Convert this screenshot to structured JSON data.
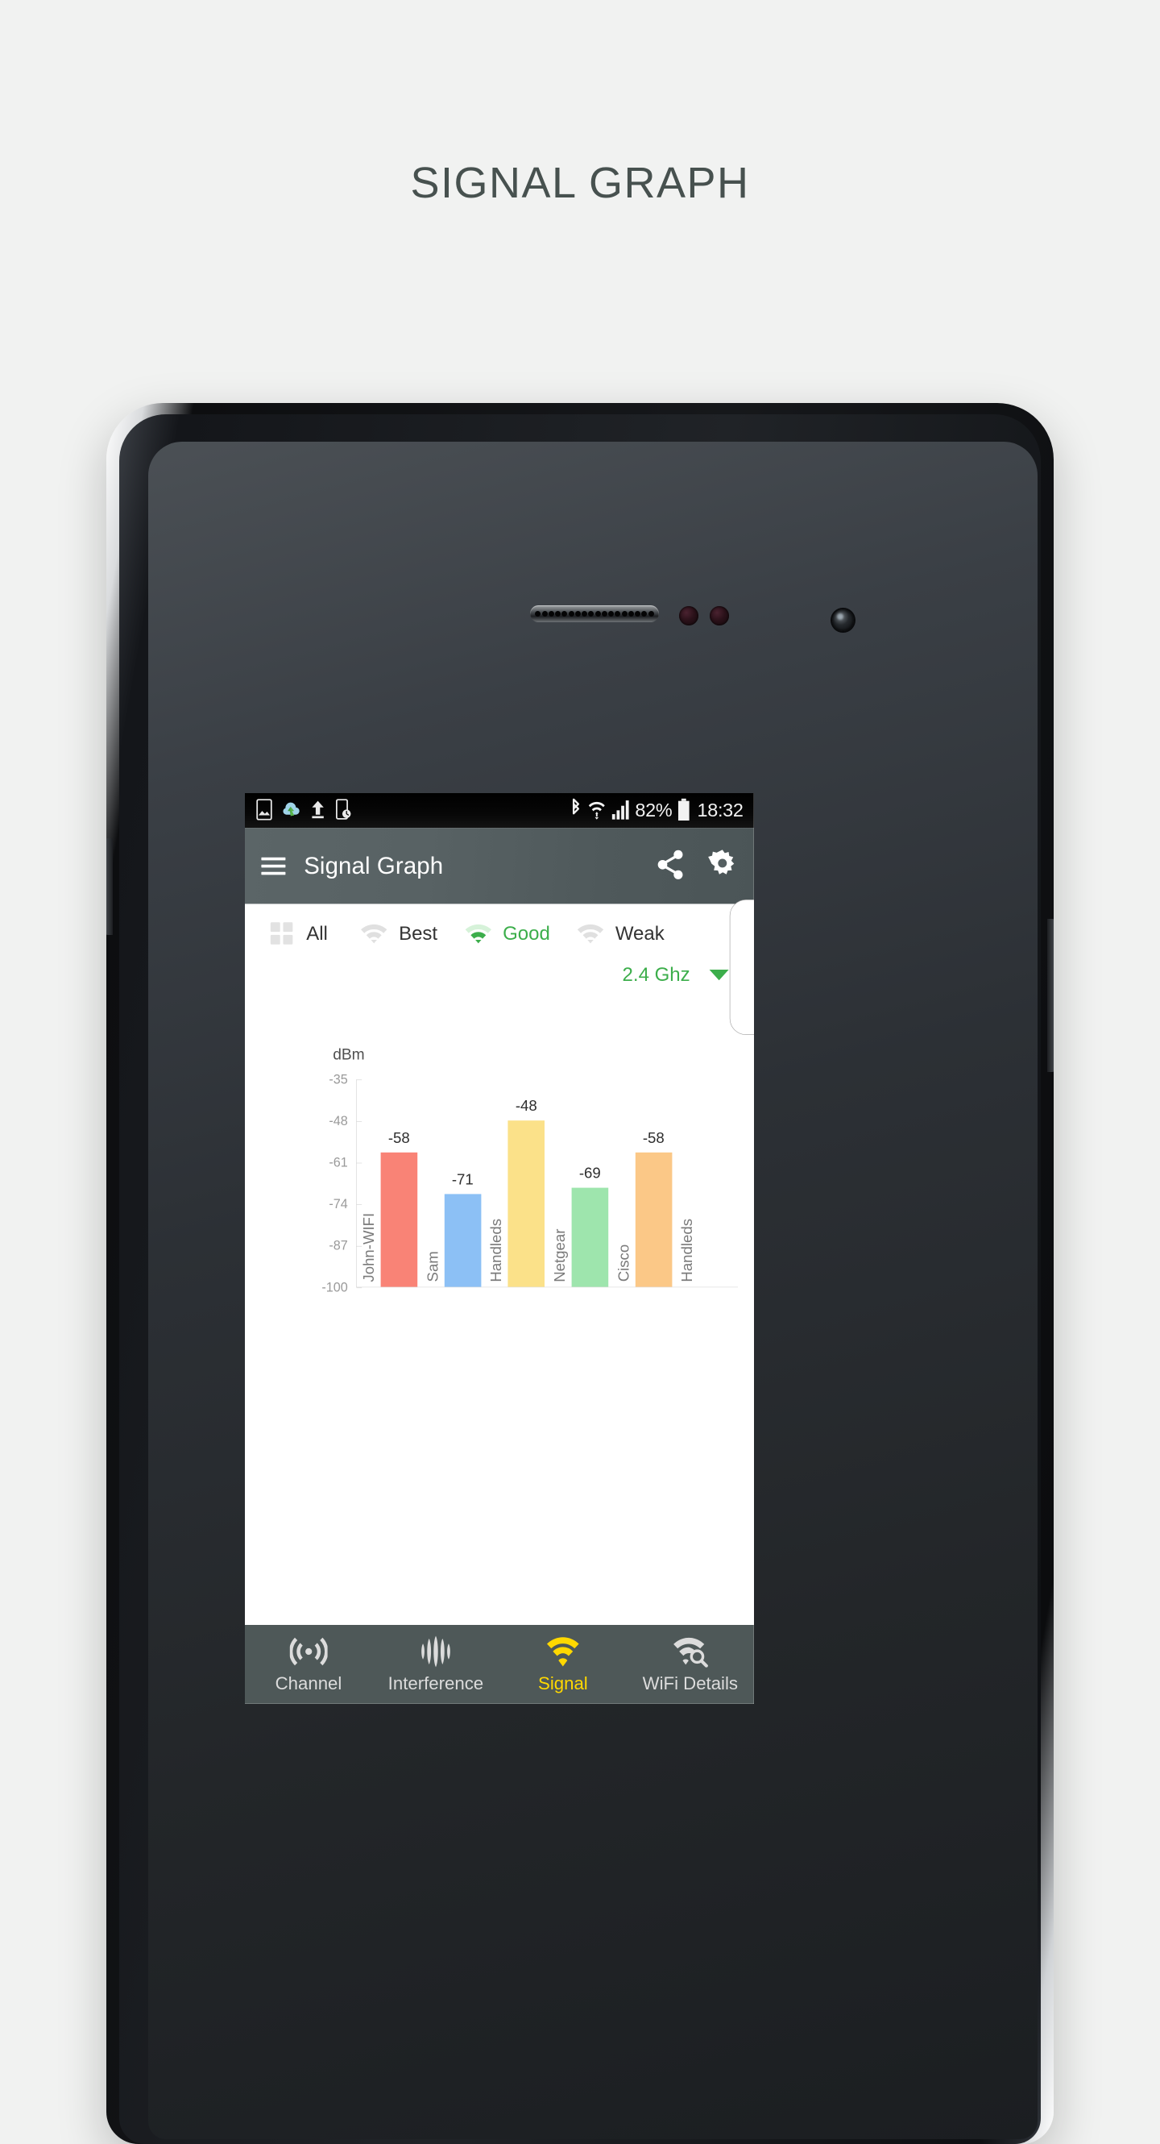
{
  "page": {
    "title": "SIGNAL GRAPH",
    "title_color": "#47514f",
    "background": "#f1f2f1"
  },
  "status_bar": {
    "battery_percent": "82%",
    "clock": "18:32",
    "left_icons": [
      "screenshot-icon",
      "weather-cloud-icon",
      "upload-arrow-icon",
      "device-clock-icon"
    ],
    "right_icons": [
      "bluetooth-icon",
      "wifi-icon",
      "cellular-signal-icon",
      "battery-icon"
    ]
  },
  "app_bar": {
    "title": "Signal Graph",
    "menu_icon": "hamburger-menu-icon",
    "share_icon": "share-icon",
    "settings_icon": "gear-icon",
    "background": "#555f61"
  },
  "filters": {
    "accent_color": "#3cae4b",
    "items": [
      {
        "label": "All",
        "icon": "grid-icon",
        "active": false
      },
      {
        "label": "Best",
        "icon": "wifi-icon",
        "active": false
      },
      {
        "label": "Good",
        "icon": "wifi-icon",
        "active": true
      },
      {
        "label": "Weak",
        "icon": "wifi-icon",
        "active": false
      }
    ]
  },
  "band_selector": {
    "value": "2.4 Ghz",
    "caret_icon": "chevron-down-icon",
    "color": "#3cae4b"
  },
  "chart_data": {
    "type": "bar",
    "title": "Signal Graph",
    "xlabel": "",
    "ylabel": "dBm",
    "ylim": [
      -100,
      -35
    ],
    "grid": false,
    "legend": "none",
    "ytick_labels": [
      "-35",
      "-48",
      "-61",
      "-74",
      "-87",
      "-100"
    ],
    "ytick_values": [
      -35,
      -48,
      -61,
      -74,
      -87,
      -100
    ],
    "categories": [
      "John-WIFI",
      "Sam",
      "Handleds",
      "Netgear",
      "Cisco",
      "Handleds"
    ],
    "values": [
      -58,
      -71,
      -48,
      -69,
      -58,
      null
    ],
    "value_labels": [
      "-58",
      "-71",
      "-48",
      "-69",
      "-58",
      ""
    ],
    "colors": [
      "#f98376",
      "#8cc0f5",
      "#fbe189",
      "#9ee5ad",
      "#fbc887",
      "#f98376"
    ],
    "clipped_last_bar": true
  },
  "bottom_nav": {
    "background": "#4e5858",
    "active_color": "#ffd800",
    "items": [
      {
        "label": "Channel",
        "icon": "broadcast-icon",
        "active": false
      },
      {
        "label": "Interference",
        "icon": "interference-icon",
        "active": false
      },
      {
        "label": "Signal",
        "icon": "wifi-icon",
        "active": true
      },
      {
        "label": "WiFi Details",
        "icon": "wifi-search-icon",
        "active": false
      }
    ]
  }
}
